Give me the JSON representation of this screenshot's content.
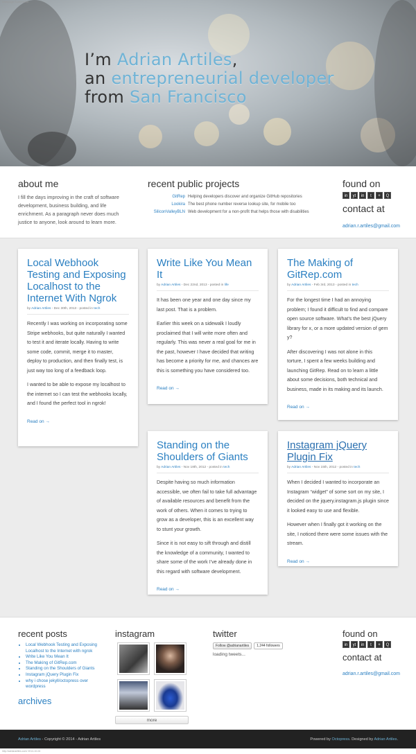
{
  "top_note": "Webpage Screenshot",
  "hero": {
    "line1_pre": "I’m ",
    "line1_name": "Adrian Artiles",
    "line1_post": ",",
    "line2_pre": "an ",
    "line2_hl": "entrepreneurial developer",
    "line3_pre": "from ",
    "line3_hl": "San Francisco"
  },
  "about": {
    "title": "about me",
    "text": "I fill the days improving in the craft of software development, business building, and life enrichment. As a paragraph never does much justice to anyone, look around to learn more."
  },
  "projects": {
    "title": "recent public projects",
    "items": [
      {
        "name": "GitRep",
        "desc": "Helping developers discover and organize GitHub repositories"
      },
      {
        "name": "Lookira",
        "desc": "The best phone number reverse lookup site, for mobile too"
      },
      {
        "name": "SiliconValleyBLN",
        "desc": "Web development for a non-profit that helps those with disabilities"
      }
    ]
  },
  "found": {
    "title": "found on",
    "icons": [
      "in",
      "yt",
      "in",
      "t",
      "+",
      "Q"
    ],
    "contact_title": "contact at",
    "email": "adrian.r.artiles@gmail.com"
  },
  "posts": [
    {
      "title": "Local Webhook Testing and Exposing Localhost to the Internet With Ngrok",
      "author": "Adrian Artiles",
      "date": "Dec 30th, 2013",
      "posted": "posted in",
      "tag": "tech",
      "paras": [
        "Recently I was working on incorporating some Stripe webhooks, but quite naturally I wanted to test it and iterate locally. Having to write some code, commit, merge it to master, deploy to production, and then finally test, is just way too long of a feedback loop.",
        "I wanted to be able to expose my localhost to the internet so I can test the webhooks locally, and I found the perfect tool in ngrok!"
      ],
      "read_on": "Read on →"
    },
    {
      "title": "Write Like You Mean It",
      "author": "Adrian Artiles",
      "date": "Dec 22nd, 2013",
      "posted": "posted in",
      "tag": "life",
      "paras": [
        "It has been one year and one day since my last post. That is a problem.",
        "Earlier this week on a sidewalk I loudly proclaimed that I will write more often and regularly. This was never a real goal for me in the past, however I have decided that writing has become a priority for me, and chances are this is something you have considered too."
      ],
      "read_on": "Read on →"
    },
    {
      "title": "The Making of GitRep.com",
      "author": "Adrian Artiles",
      "date": "Feb 3rd, 2013",
      "posted": "posted in",
      "tag": "tech",
      "paras": [
        "For the longest time I had an annoying problem; I found it difficult to find and compare open source software. What’s the best jQuery library for x, or a more updated version of gem y?",
        "After discovering I was not alone in this torture, I spent a few weeks building and launching GitRep. Read on to learn a little about some decisions, both technical and business, made in its making and its launch."
      ],
      "read_on": "Read on →"
    },
    {
      "title": "Standing on the Shoulders of Giants",
      "author": "Adrian Artiles",
      "date": "Nov 18th, 2012",
      "posted": "posted in",
      "tag": "tech",
      "paras": [
        "Despite having so much information accessible, we often fail to take full advantage of available resources and benefit from the work of others. When it comes to trying to grow as a developer, this is an excellent way to stunt your growth.",
        "Since it is not easy to sift through and distill the knowledge of a community, I wanted to share some of the work I’ve already done in this regard with software development."
      ],
      "read_on": "Read on →"
    },
    {
      "title": "Instagram jQuery Plugin Fix",
      "author": "Adrian Artiles",
      "date": "Nov 15th, 2012",
      "posted": "posted in",
      "tag": "tech",
      "paras": [
        "When I decided I wanted to incorporate an Instagram “widget” of some sort on my site, I decided on the jquery.instagram.js plugin since it looked easy to use and flexible.",
        "However when I finally got it working on the site, I noticed there were some issues with the stream."
      ],
      "read_on": "Read on →"
    }
  ],
  "recent_posts": {
    "title": "recent posts",
    "items": [
      "Local Webhook Testing and Exposing Localhost to the Internet with ngrok",
      "Write Like You Mean It",
      "The Making of GitRep.com",
      "Standing on the Shoulders of Giants",
      "Instagram jQuery Plugin Fix",
      "why i chose jekyll/octopress over wordpress"
    ],
    "archives": "archives"
  },
  "instagram": {
    "title": "instagram",
    "more": "more"
  },
  "twitter": {
    "title": "twitter",
    "follow": "Follow @adrianartiles",
    "count": "1,244 followers",
    "loading": "loading tweets..."
  },
  "bottom": {
    "left_link": "Adrian Artiles",
    "left_text": " - Copyright © 2014 - Adrian Artiles",
    "powered": "Powered by ",
    "powered_link": "Octopress",
    "designed": ". Designed by ",
    "designed_link": "Adrian Artiles",
    "end": "."
  },
  "under_note": "http://adrianartiles.com/ 2014-10-04"
}
